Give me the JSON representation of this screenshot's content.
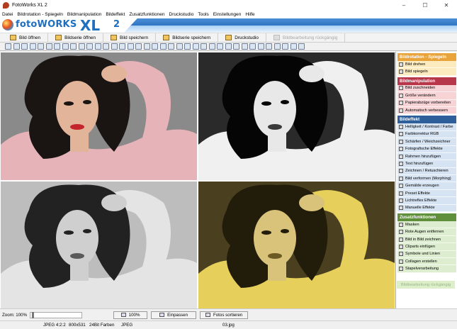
{
  "window": {
    "title": "FotoWorks XL 2",
    "minimize": "–",
    "maximize": "☐",
    "close": "✕"
  },
  "menu": [
    "Datei",
    "Bildrotation - Spiegeln",
    "Bildmanipulation",
    "Bildeffekt",
    "Zusatzfunktionen",
    "Druckstudio",
    "Tools",
    "Einstellungen",
    "Hilfe"
  ],
  "logo": {
    "brand_a": "foto",
    "brand_b": "WORKS",
    "xl": "XL",
    "version": "2"
  },
  "toolbar": [
    {
      "label": "Bild öffnen",
      "enabled": true
    },
    {
      "label": "Bildserie öffnen",
      "enabled": true
    },
    {
      "label": "Bild speichern",
      "enabled": true
    },
    {
      "label": "Bildserie speichern",
      "enabled": true
    },
    {
      "label": "Druckstudio",
      "enabled": true
    },
    {
      "label": "Bildbearbeitung rückgängig",
      "enabled": false
    }
  ],
  "sidebar": {
    "sections": [
      {
        "title": "Bildrotation - Spiegeln",
        "color": "#e8a33a",
        "item_bg": "#fdebc0",
        "items": [
          "Bild drehen",
          "Bild spiegeln"
        ]
      },
      {
        "title": "Bildmanipulation",
        "color": "#b8364a",
        "item_bg": "#f7d3d6",
        "items": [
          "Bild zuschneiden",
          "Größe verändern",
          "Papierabzüge vorbereiten",
          "Automatisch verbessern"
        ]
      },
      {
        "title": "Bildeffekt",
        "color": "#2f5f9a",
        "item_bg": "#d6e3f2",
        "items": [
          "Helligkeit / Kontrast / Farbe",
          "Farbkorrektur RGB",
          "Schärfen / Weichzeichner",
          "Fotografische Effekte",
          "Rahmen hinzufügen",
          "Text hinzufügen",
          "Zeichnen / Retuschieren",
          "Bild verformen (Morphing)",
          "Gemälde erzeugen",
          "Preset Effekte",
          "Lichtreflex Effekte",
          "Manuelle Effekte"
        ]
      },
      {
        "title": "Zusatzfunktionen",
        "color": "#5f8f3a",
        "item_bg": "#ddeed0",
        "items": [
          "Masken",
          "Rote Augen entfernen",
          "Bild in Bild zeichnen",
          "Cliparts einfügen",
          "Symbole und Linien",
          "Collagen erstellen",
          "Stapelverarbeitung"
        ]
      }
    ],
    "undo_label": "Bildbearbeitung rückgängig"
  },
  "photos": [
    {
      "name": "pink-tint",
      "bg": "#8a8a8a",
      "sweater": "#e6b3b8",
      "skin": "#e2b59a",
      "hair": "#1a1412",
      "lips": "#c4242c"
    },
    {
      "name": "black-white-contrast",
      "bg": "#2a2a2a",
      "sweater": "#f0f0f0",
      "skin": "#e8e8e8",
      "hair": "#050505",
      "lips": "#3a3a3a"
    },
    {
      "name": "grayscale",
      "bg": "#bdbdbd",
      "sweater": "#e4e4e4",
      "skin": "#cfcfcf",
      "hair": "#222222",
      "lips": "#5a5a5a"
    },
    {
      "name": "yellow-tint",
      "bg": "#4a4020",
      "sweater": "#e6cf5a",
      "skin": "#d9c27a",
      "hair": "#221c0a",
      "lips": "#6b5a22"
    }
  ],
  "zoombar": {
    "zoom_label": "Zoom: 100%",
    "btn_100": "100%",
    "btn_fit": "Einpassen",
    "btn_sort": "Fotos sortieren"
  },
  "status": {
    "format": "JPEG 4:2:2",
    "size": "800x531",
    "colors": "24Bit Farben",
    "type": "JPEG",
    "file": "03.jpg"
  }
}
